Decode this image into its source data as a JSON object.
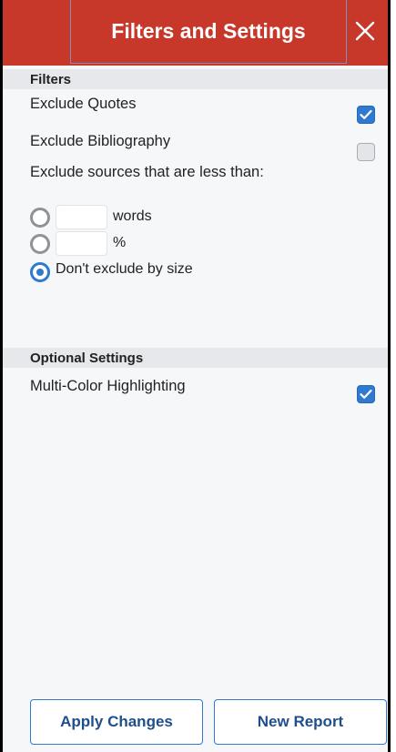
{
  "header": {
    "title": "Filters and Settings",
    "close_icon": "close-icon"
  },
  "filters": {
    "section_title": "Filters",
    "exclude_quotes": {
      "label": "Exclude Quotes",
      "checked": true
    },
    "exclude_bibliography": {
      "label": "Exclude Bibliography",
      "checked": false
    },
    "exclude_small": {
      "label": "Exclude sources that are less than:",
      "words_value": "",
      "words_unit": "words",
      "percent_value": "",
      "percent_unit": "%",
      "no_size_label": "Don't exclude by size",
      "selected": "no_size"
    }
  },
  "optional": {
    "section_title": "Optional Settings",
    "multi_color": {
      "label": "Multi-Color Highlighting",
      "checked": true
    }
  },
  "footer": {
    "apply_label": "Apply Changes",
    "new_report_label": "New Report"
  },
  "colors": {
    "header_bg": "#c7382b",
    "accent": "#2f7ad0"
  }
}
